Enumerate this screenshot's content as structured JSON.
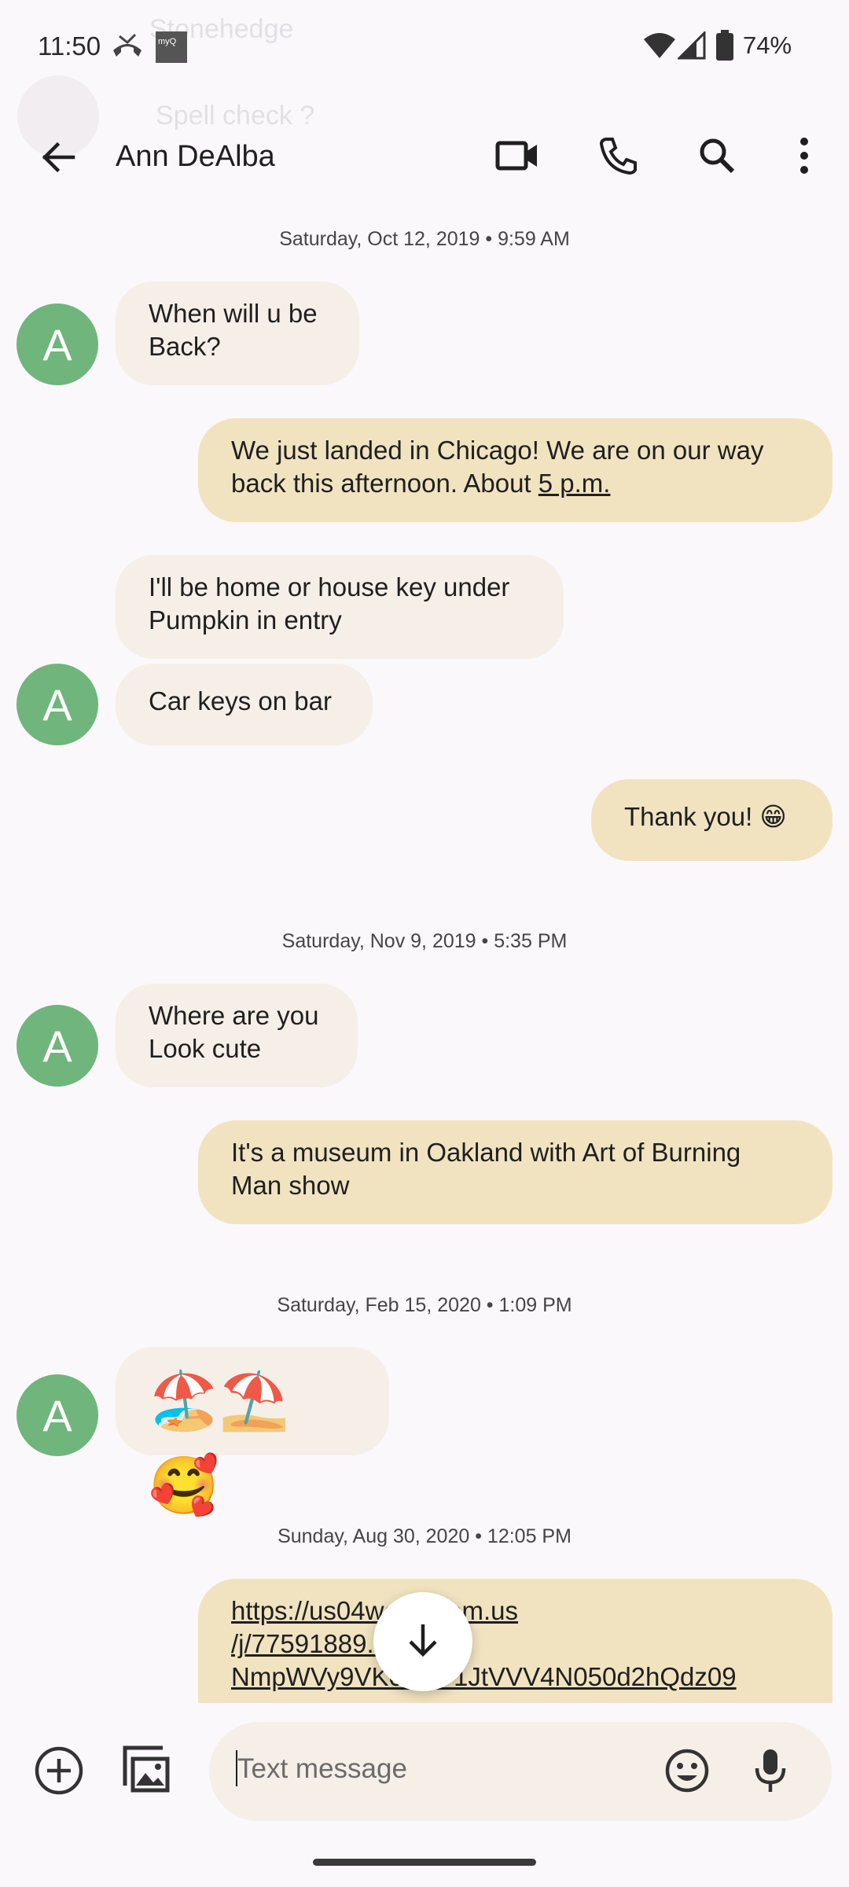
{
  "status_bar": {
    "time": "11:50",
    "battery": "74%",
    "myq_label": "myQ"
  },
  "ghost_overlay": {
    "title": "Stonehedge",
    "subtitle": "Spell check ?"
  },
  "app_bar": {
    "contact_name": "Ann DeAlba",
    "icons": [
      "back-arrow-icon",
      "video-call-icon",
      "phone-icon",
      "search-icon",
      "more-vert-icon"
    ]
  },
  "contact_avatar_letter": "A",
  "dates": [
    "Saturday, Oct 12, 2019 • 9:59 AM",
    "Saturday, Nov 9, 2019 • 5:35 PM",
    "Saturday, Feb 15, 2020 • 1:09 PM",
    "Sunday, Aug 30, 2020 • 12:05 PM"
  ],
  "messages": {
    "m1_line1": "When will u be",
    "m1_line2": "Back?",
    "m2_line1": "We just landed in Chicago! We are on our way",
    "m2_line2_prefix": "back this afternoon. About ",
    "m2_line2_link": "5 p.m.",
    "m3_line1": "I'll be home or house key under",
    "m3_line2": "Pumpkin in entry",
    "m4": "Car keys on bar",
    "m5": "Thank you! 😁",
    "m6_line1": "Where are you",
    "m6_line2": "Look cute",
    "m7_line1": "It's a museum in Oakland with Art of Burning",
    "m7_line2": "Man show",
    "m8_emoji": "🏖️⛱️🥰",
    "m9_line1": "https://us04web.zoom.us",
    "m9_line2": "/j/77591889...wd=",
    "m9_line3": "NmpWVy9VK0NnV1JtVVV4N050d2hQdz09"
  },
  "compose": {
    "placeholder": "Text message",
    "icons": [
      "add-circle-icon",
      "gallery-icon",
      "emoji-icon",
      "mic-icon"
    ]
  },
  "colors": {
    "incoming_bubble": "#f5efe8",
    "outgoing_bubble": "#f1e3c0",
    "avatar": "#6fb57c",
    "background": "#fbf8fb"
  }
}
